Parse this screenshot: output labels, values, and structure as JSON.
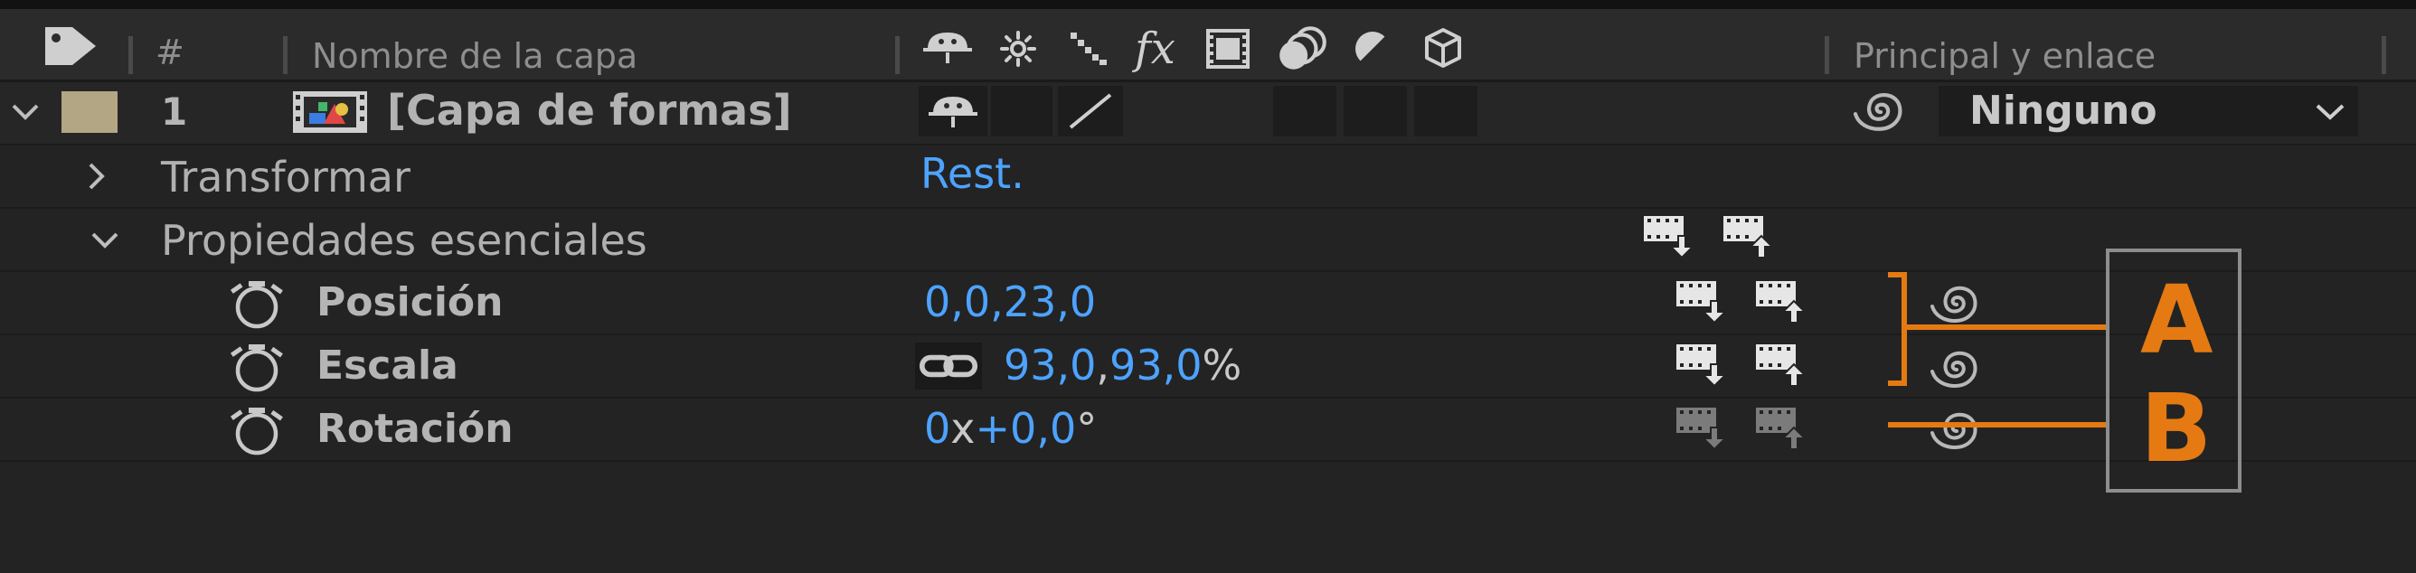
{
  "header": {
    "num_label": "#",
    "layer_name_label": "Nombre de la capa",
    "switch_fx_label": "fx",
    "parent_label": "Principal y enlace",
    "switch_icons": [
      "shy-icon",
      "collapse-sun-icon",
      "quality-icon",
      "fx-icon",
      "frame-blend-icon",
      "motion-blur-icon",
      "adjustment-layer-icon",
      "3d-layer-icon"
    ]
  },
  "layer": {
    "number": "1",
    "name": "[Capa de formas]",
    "label_color": "#b3a684",
    "parent_value": "Ninguno"
  },
  "groups": {
    "transform_label": "Transformar",
    "reset_label": "Rest.",
    "essential_label": "Propiedades esenciales"
  },
  "properties": [
    {
      "name": "Posición",
      "value": "0,0,23,0"
    },
    {
      "name": "Escala",
      "value_x": "93,0",
      "value_y": "93,0",
      "unit": "%"
    },
    {
      "name": "Rotación",
      "value_revs": "0",
      "value_deg": "+0,0"
    }
  ],
  "scale_sep": ",",
  "rotation_x": "x",
  "rotation_deg_sign": "°",
  "callouts": {
    "a_label": "A",
    "b_label": "B"
  },
  "colors": {
    "accent_blue": "#4da3ff",
    "callout_orange": "#e57a12",
    "background": "#232323",
    "header": "#2b2b2b"
  }
}
